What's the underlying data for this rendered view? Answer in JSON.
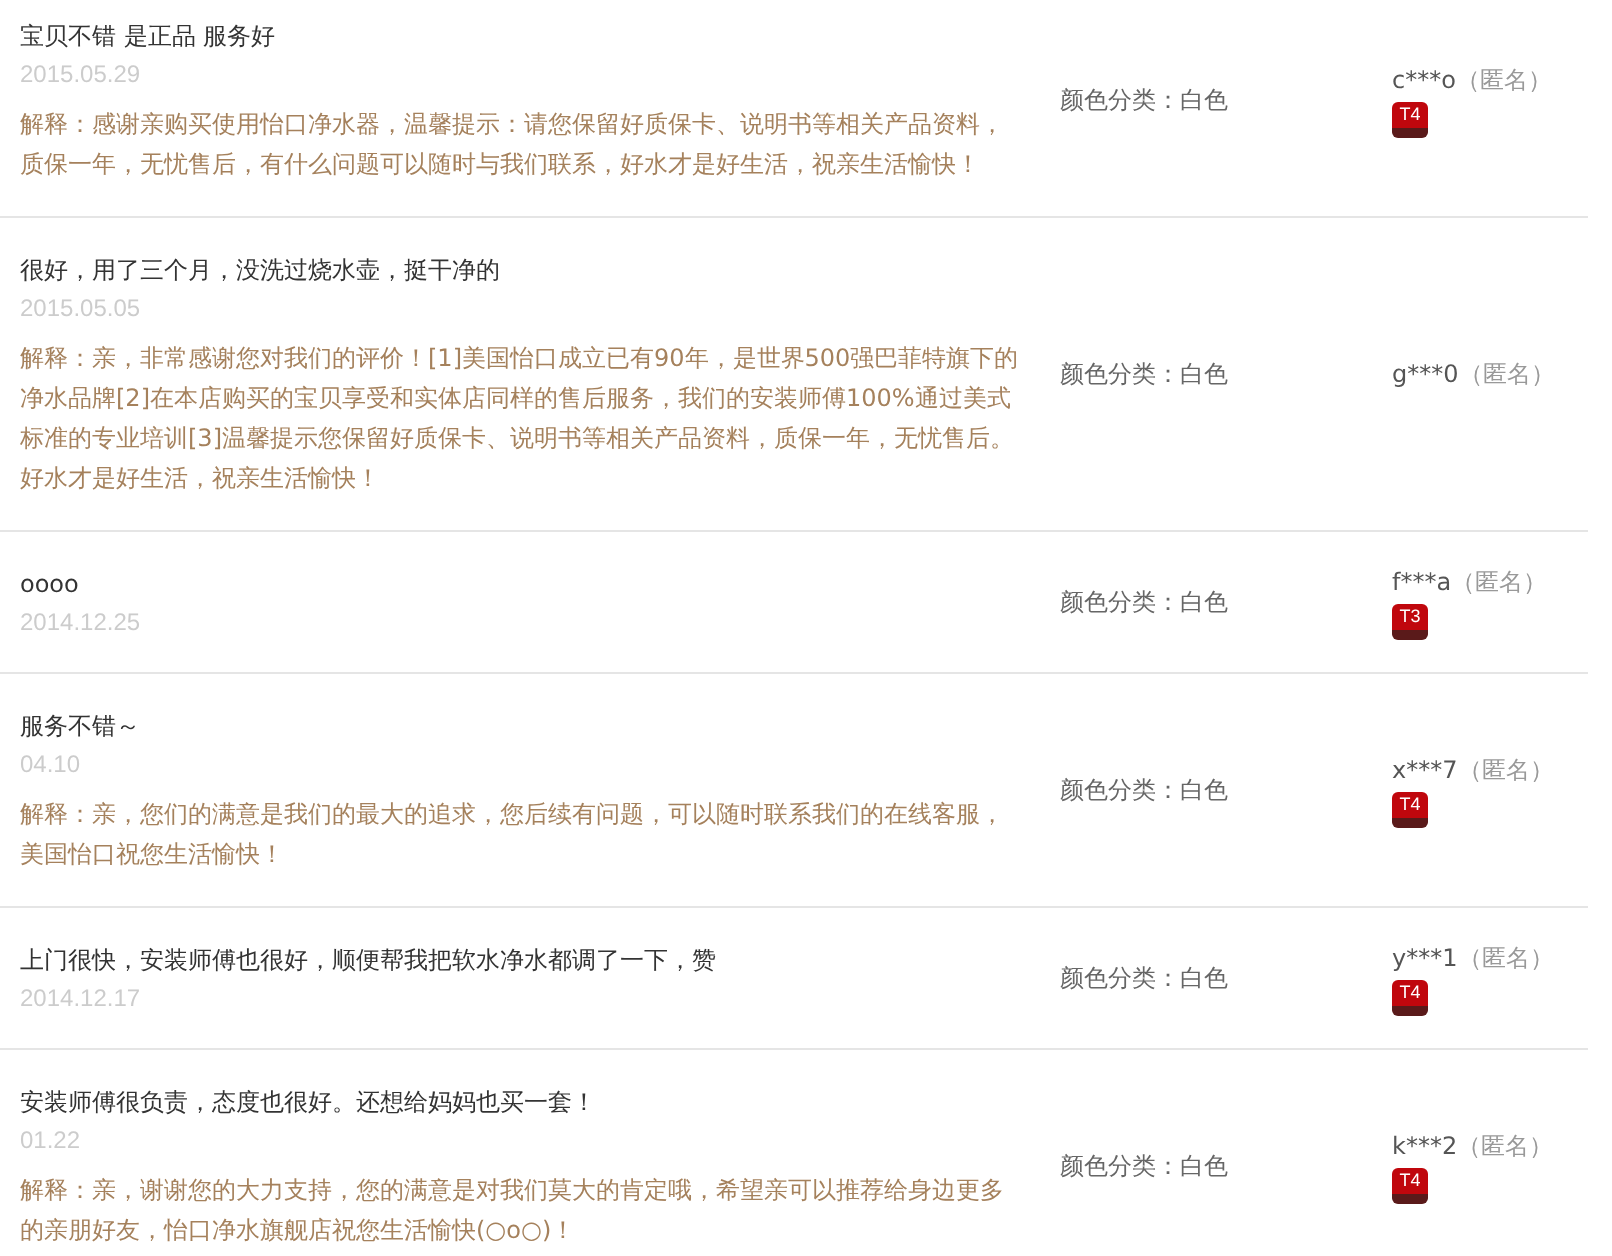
{
  "reviews": [
    {
      "text": "宝贝不错 是正品 服务好",
      "date": "2015.05.29",
      "reply": "解释：感谢亲购买使用怡口净水器，温馨提示：请您保留好质保卡、说明书等相关产品资料，质保一年，无忧售后，有什么问题可以随时与我们联系，好水才是好生活，祝亲生活愉快！",
      "spec": "颜色分类：白色",
      "user": "c***o",
      "anon": "（匿名）",
      "badge": "T4"
    },
    {
      "text": "很好，用了三个月，没洗过烧水壶，挺干净的",
      "date": "2015.05.05",
      "reply": "解释：亲，非常感谢您对我们的评价！[1]美国怡口成立已有90年，是世界500强巴菲特旗下的净水品牌[2]在本店购买的宝贝享受和实体店同样的售后服务，我们的安装师傅100%通过美式标准的专业培训[3]温馨提示您保留好质保卡、说明书等相关产品资料，质保一年，无忧售后。好水才是好生活，祝亲生活愉快！",
      "spec": "颜色分类：白色",
      "user": "g***0",
      "anon": "（匿名）"
    },
    {
      "text": "oooo",
      "date": "2014.12.25",
      "spec": "颜色分类：白色",
      "user": "f***a",
      "anon": "（匿名）",
      "badge": "T3"
    },
    {
      "text": "服务不错～",
      "date": "04.10",
      "reply": "解释：亲，您们的满意是我们的最大的追求，您后续有问题，可以随时联系我们的在线客服，美国怡口祝您生活愉快！",
      "spec": "颜色分类：白色",
      "user": "x***7",
      "anon": "（匿名）",
      "badge": "T4"
    },
    {
      "text": "上门很快，安装师傅也很好，顺便帮我把软水净水都调了一下，赞",
      "date": "2014.12.17",
      "spec": "颜色分类：白色",
      "user": "y***1",
      "anon": "（匿名）",
      "badge": "T4"
    },
    {
      "text": "安装师傅很负责，态度也很好。还想给妈妈也买一套！",
      "date": "01.22",
      "reply": "解释：亲，谢谢您的大力支持，您的满意是对我们莫大的肯定哦，希望亲可以推荐给身边更多的亲朋好友，怡口净水旗舰店祝您生活愉快(○o○)！",
      "spec": "颜色分类：白色",
      "user": "k***2",
      "anon": "（匿名）",
      "badge": "T4"
    }
  ]
}
